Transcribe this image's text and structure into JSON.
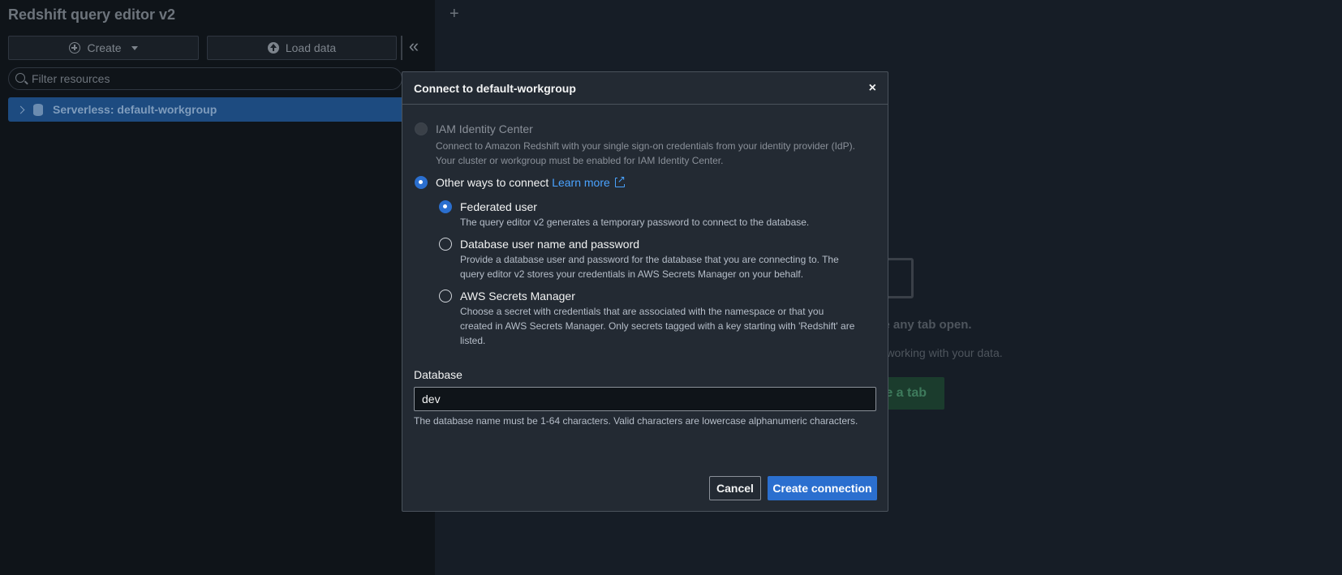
{
  "sidebar": {
    "app_title": "Redshift query editor v2",
    "create_label": "Create",
    "load_data_label": "Load data",
    "filter_placeholder": "Filter resources",
    "tree_item": "Serverless: default-workgroup"
  },
  "main": {
    "empty_title": "ve any tab open.",
    "empty_sub": "rt working with your data.",
    "empty_button": "te a tab"
  },
  "modal": {
    "title": "Connect to default-workgroup",
    "close": "×",
    "options": [
      {
        "label": "IAM Identity Center",
        "desc": "Connect to Amazon Redshift with your single sign-on credentials from your identity provider (IdP). Your cluster or workgroup must be enabled for IAM Identity Center.",
        "state": "disabled"
      },
      {
        "label": "Other ways to connect",
        "learn_more": "Learn more",
        "state": "checked"
      }
    ],
    "sub_options": [
      {
        "label": "Federated user",
        "desc": "The query editor v2 generates a temporary password to connect to the database.",
        "state": "checked"
      },
      {
        "label": "Database user name and password",
        "desc": "Provide a database user and password for the database that you are connecting to. The query editor v2 stores your credentials in AWS Secrets Manager on your behalf.",
        "state": "unchecked"
      },
      {
        "label": "AWS Secrets Manager",
        "desc": "Choose a secret with credentials that are associated with the namespace or that you created in AWS Secrets Manager. Only secrets tagged with a key starting with 'Redshift' are listed.",
        "state": "unchecked"
      }
    ],
    "database_label": "Database",
    "database_value": "dev",
    "database_hint": "The database name must be 1-64 characters. Valid characters are lowercase alphanumeric characters.",
    "cancel_label": "Cancel",
    "create_label": "Create connection"
  },
  "colors": {
    "primary": "#2b6fcf",
    "link": "#4aa3ff",
    "modal_bg": "#232a33"
  }
}
